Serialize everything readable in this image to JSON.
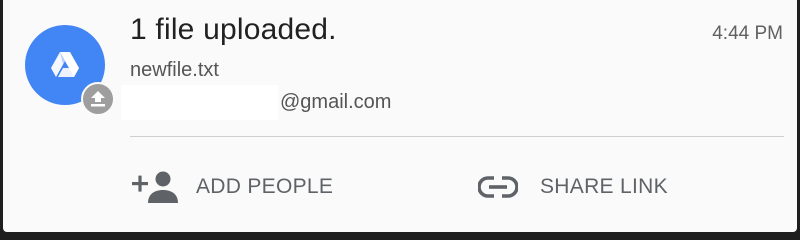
{
  "notification": {
    "title": "1 file uploaded.",
    "time": "4:44 PM",
    "filename": "newfile.txt",
    "account_domain": "@gmail.com",
    "app_icon": "google-drive-icon",
    "badge_icon": "upload-icon"
  },
  "actions": {
    "add_people": {
      "label": "ADD PEOPLE",
      "icon": "person-add-icon"
    },
    "share_link": {
      "label": "SHARE LINK",
      "icon": "link-icon"
    }
  },
  "colors": {
    "accent": "#4285f4",
    "badge": "#9e9e9e",
    "background": "#fafafa"
  }
}
